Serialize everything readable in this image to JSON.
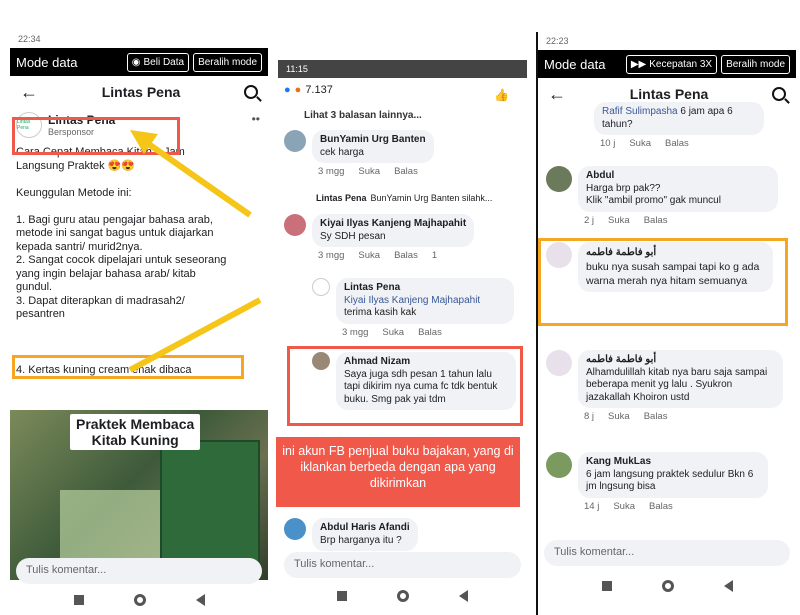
{
  "panel1": {
    "status": "22:34",
    "mode_label": "Mode data",
    "buy_data": "Beli Data",
    "switch_mode": "Beralih mode",
    "page_title": "Lintas Pena",
    "poster_name": "Lintas Pena",
    "poster_sub": "Bersponsor",
    "post_text": "Cara Cepat Membaca Kitab 1 Jam\nLangsung Praktek 😍😍\n\nKeunggulan Metode ini:\n\n1. Bagi guru atau pengajar bahasa arab,\nmetode ini sangat bagus untuk diajarkan\nkepada santri/ murid2nya.\n2. Sangat cocok dipelajari untuk seseorang\nyang ingin belajar bahasa arab/ kitab\ngundul.\n3. Dapat diterapkan di madrasah2/\npesantren",
    "highlight_line": "4. Kertas kuning cream enak dibaca",
    "image_title": "Praktek Membaca\nKitab Kuning",
    "comment_placeholder": "Tulis komentar..."
  },
  "panel2": {
    "status": "11:15",
    "reactions": "7.137",
    "see_replies": "Lihat 3 balasan lainnya...",
    "comments": [
      {
        "name": "BunYamin Urg Banten",
        "text": "cek harga",
        "time": "3 mgg",
        "like": "Suka",
        "reply": "Balas"
      },
      {
        "name": "Lintas Pena",
        "text": "BunYamin Urg Banten silahk...",
        "time": "",
        "like": "",
        "reply": ""
      },
      {
        "name": "Kiyai Ilyas Kanjeng Majhapahit",
        "text": "Sy SDH pesan",
        "time": "3 mgg",
        "like": "Suka",
        "reply": "Balas",
        "count": "1"
      },
      {
        "name": "Lintas Pena",
        "mention": "Kiyai Ilyas Kanjeng Majhapahit",
        "text": "terima kasih kak",
        "time": "3 mgg",
        "like": "Suka",
        "reply": "Balas"
      },
      {
        "name": "Ahmad Nizam",
        "text": "Saya juga sdh pesan 1 tahun lalu tapi dikirim nya cuma fc tdk bentuk buku. Smg pak yai tdm",
        "time": "",
        "like": "",
        "reply": ""
      },
      {
        "name": "Abdul Haris Afandi",
        "text": "Brp harganya itu ?",
        "time": "",
        "like": "",
        "reply": ""
      }
    ],
    "caption": "ini akun FB penjual buku bajakan, yang di iklankan berbeda dengan apa yang dikirimkan",
    "comment_placeholder": "Tulis komentar..."
  },
  "panel3": {
    "status": "22:23",
    "mode_label": "Mode data",
    "speed": "Kecepatan 3X",
    "switch_mode": "Beralih mode",
    "page_title": "Lintas Pena",
    "comments": [
      {
        "name": "",
        "mention": "Rafif Sulimpasha",
        "text": "6 jam apa 6 tahun?",
        "time": "10 j",
        "like": "Suka",
        "reply": "Balas"
      },
      {
        "name": "Abdul",
        "text": "Harga brp pak??\nKlik \"ambil promo\" gak muncul",
        "time": "2 j",
        "like": "Suka",
        "reply": "Balas"
      },
      {
        "name": "أبو فاطمة فاطمه",
        "text": "buku nya susah sampai tapi ko g ada warna merah nya hitam semuanya",
        "time": "",
        "like": "",
        "reply": ""
      },
      {
        "name": "أبو فاطمة فاطمه",
        "text": "Alhamdulillah kitab nya baru saja sampai beberapa menit yg lalu . Syukron jazakallah Khoiron ustd",
        "time": "8 j",
        "like": "Suka",
        "reply": "Balas"
      },
      {
        "name": "Kang MukLas",
        "text": "6 jam langsung praktek sedulur Bkn 6 jm lngsung bisa",
        "time": "14 j",
        "like": "Suka",
        "reply": "Balas"
      }
    ],
    "comment_placeholder": "Tulis komentar..."
  }
}
